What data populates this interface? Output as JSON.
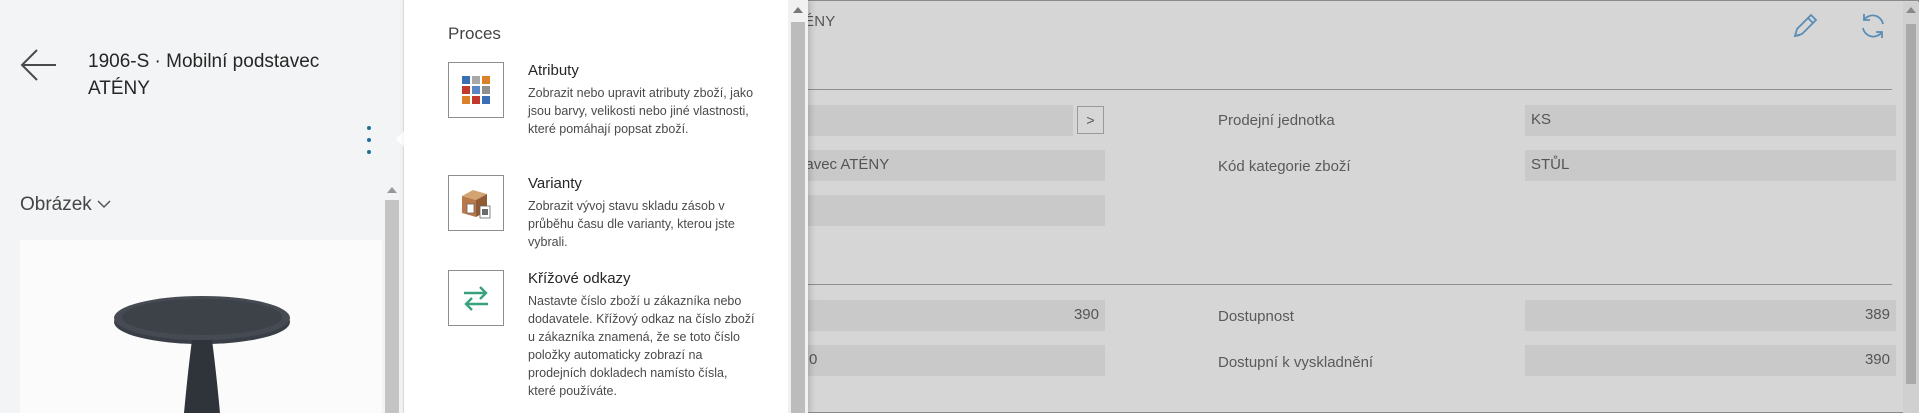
{
  "background": {
    "title": "C ATÉNY",
    "edit_icon": "pencil-icon",
    "refresh_icon": "refresh-icon",
    "expand_button_label": ">",
    "fields": {
      "description_partial": "odstavec ATÉNY",
      "sales_unit_label": "Prodejní jednotka",
      "sales_unit_value": "KS",
      "item_category_label": "Kód kategorie zboží",
      "item_category_value": "STŮL",
      "inventory_value": "390",
      "available_label": "Dostupnost",
      "available_value": "389",
      "partial_value": "0",
      "available_to_stock_label": "Dostupní k vyskladnění",
      "available_to_stock_value": "390"
    }
  },
  "panel": {
    "item_title": "1906-S · Mobilní podstavec ATÉNY",
    "back_icon": "arrow-left-icon",
    "more_icon": "more-vertical-icon",
    "picture_section": "Obrázek",
    "picture_chevron": "chevron-down-icon"
  },
  "menu": {
    "heading": "Proces",
    "items": [
      {
        "title": "Atributy",
        "description": "Zobrazit nebo upravit atributy zboží, jako jsou barvy, velikosti nebo jiné vlastnosti, které pomáhají popsat zboží.",
        "icon": "attributes-icon"
      },
      {
        "title": "Varianty",
        "description": "Zobrazit vývoj stavu skladu zásob v průběhu času dle varianty, kterou jste vybrali.",
        "icon": "variants-icon"
      },
      {
        "title": "Křížové odkazy",
        "description": "Nastavte číslo zboží u zákazníka nebo dodavatele. Křížový odkaz na číslo zboží u zákazníka znamená, že se toto číslo položky automaticky zobrazí na prodejních dokladech namísto čísla, které používáte.",
        "icon": "cross-reference-icon"
      }
    ]
  },
  "colors": {
    "accent": "#1f6f9e",
    "dim_background": "#d6d6d6",
    "panel_background": "#f3f4f5"
  }
}
